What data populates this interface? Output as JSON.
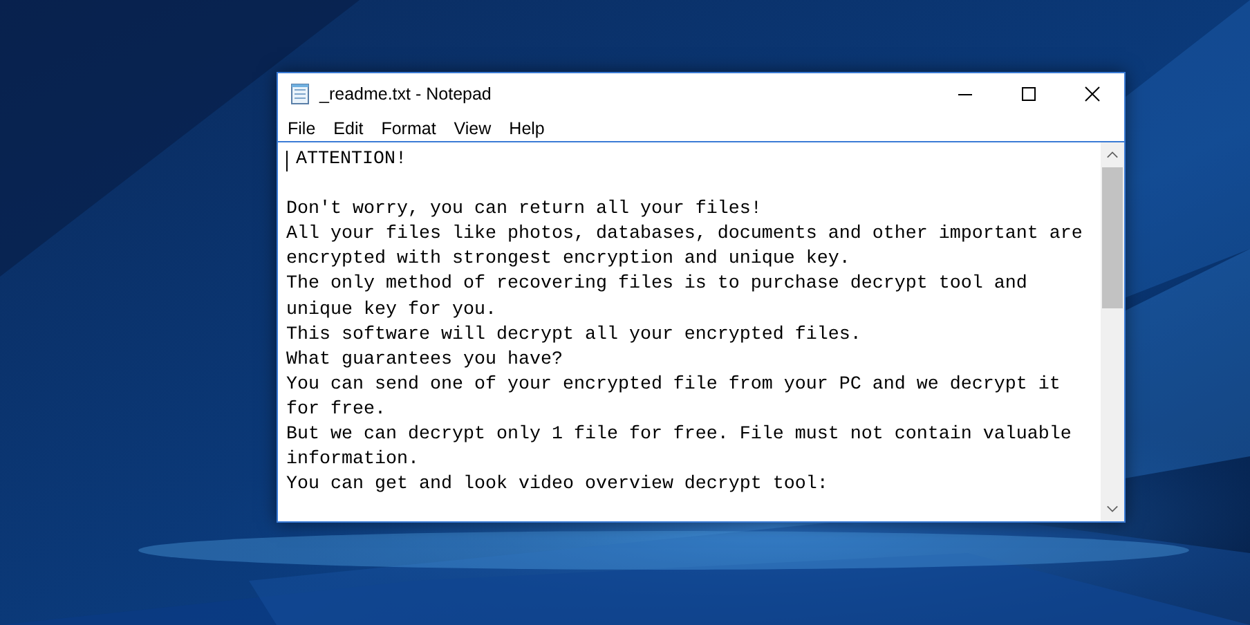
{
  "window": {
    "title": "_readme.txt - Notepad"
  },
  "menu": [
    "File",
    "Edit",
    "Format",
    "View",
    "Help"
  ],
  "paragraphs": [
    [
      "ATTENTION!"
    ],
    [
      "Don't worry, you can return all your files!",
      "All your files like photos, databases, documents and other important are",
      "encrypted with strongest encryption and unique key.",
      "The only method of recovering files is to purchase decrypt tool and",
      "unique key for you.",
      "This software will decrypt all your encrypted files.",
      "What guarantees you have?",
      "You can send one of your encrypted file from your PC and we decrypt it",
      "for free.",
      "But we can decrypt only 1 file for free. File must not contain valuable",
      "information.",
      "You can get and look video overview decrypt tool:"
    ]
  ]
}
